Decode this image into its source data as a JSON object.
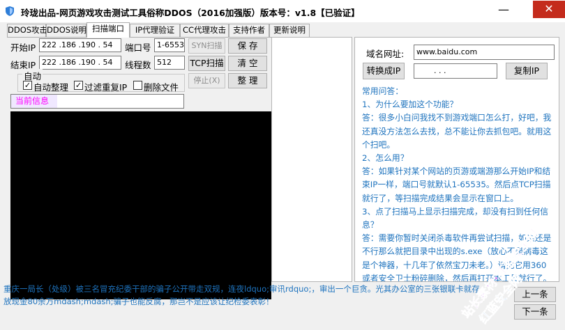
{
  "window": {
    "title": "玲珑出品-网页游戏攻击测试工具俗称DDOS（2016加强版）版本号：v1.8【已验证】",
    "minimize_glyph": "—",
    "close_glyph": "✕"
  },
  "tabs": [
    {
      "label": "DDOS攻击"
    },
    {
      "label": "DDOS说明"
    },
    {
      "label": "扫描端口"
    },
    {
      "label": "IP代理验证"
    },
    {
      "label": "CC代理攻击"
    },
    {
      "label": "支持作者"
    },
    {
      "label": "更新说明"
    }
  ],
  "scan": {
    "start_ip_label": "开始IP",
    "start_ip_value": "222 .186 .190 . 54",
    "end_ip_label": "结束IP",
    "end_ip_value": "222 .186 .190 . 54",
    "port_label": "端口号",
    "port_value": "1-65535",
    "threads_label": "线程数",
    "threads_value": "512",
    "syn_button": "SYN扫描",
    "tcp_button": "TCP扫描",
    "stop_button": "停止(X)",
    "save_button": "保 存",
    "clear_button": "清 空",
    "tidy_button": "整 理",
    "auto_group_label": "自动",
    "auto_tidy_label": "自动整理",
    "filter_dup_label": "过滤重复IP",
    "delete_file_label": "删除文件",
    "current_info_label": "当前信息"
  },
  "domain": {
    "label": "域名网址:",
    "value": "www.baidu.com",
    "convert_button": "转换成IP",
    "ip_value": ".       .       .",
    "copy_button": "复制IP"
  },
  "faq": {
    "lines": [
      "常用问答：",
      "1、为什么要加这个功能？",
      "答：很多小白问我找不到游戏端口怎么打，好吧，我",
      "还真没方法怎么去找，总不能让你去抓包吧。就用这",
      "个扫吧。",
      "2、怎么用？",
      "答：如果针对某个网站的页游或端游那么开始IP和结",
      "束IP一样，端口号就默认1-65535。然后点TCP扫描",
      "就行了，等扫描完成结果会显示在窗口上。",
      "3、点了扫描马上显示扫描完成，却没有扫到任何信",
      "息？",
      "答：需要你暂时关闭杀毒软件再尝试扫描，如果还是",
      "不行那么就把目录中出现的s.exe（放心不是病毒这",
      "是个神器，十几年了依然宝刀未老。）请把它用360",
      "或者安全卫士粉碎删除，然后再打开本工具就行了。"
    ]
  },
  "footer": {
    "lines": [
      "重庆一局长（处级）被三名冒充纪委干部的骗子公开带走双规，连夜ldquo;审讯rdquo;，审出一个巨贪。光其办公室的三张银联卡就存",
      "放现金80余万mdash;mdash;骗子也能反腐，那岂不是应该让纪检委表彰！"
    ],
    "prev_button": "上一条",
    "next_button": "下一条"
  },
  "watermark": {
    "line1": "站长素材·红蓝安全网",
    "line2": "红蓝安全网"
  },
  "colors": {
    "accent_blue": "#1e73be",
    "current_info": "#ff00ff",
    "close_red": "#c42b1c"
  }
}
